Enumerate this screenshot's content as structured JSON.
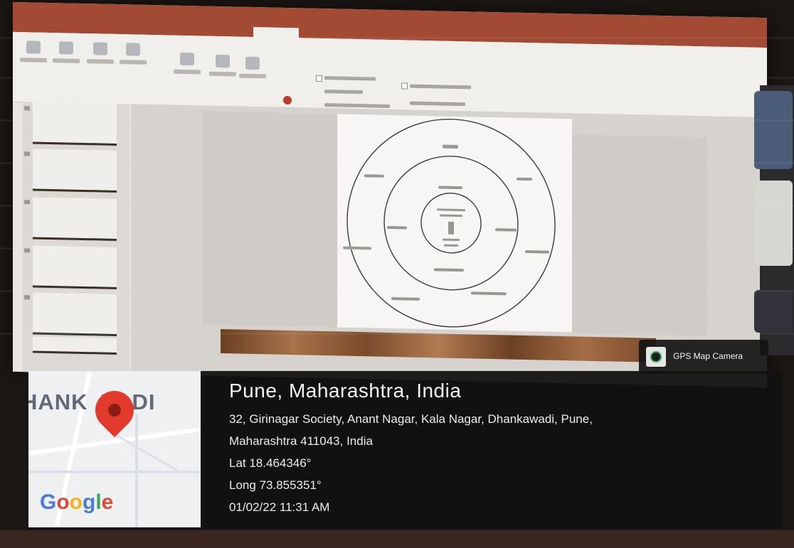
{
  "gps_overlay": {
    "badge_label": "GPS Map Camera",
    "place_title": "Pune, Maharashtra, India",
    "address_line1": "32, Girinagar Society, Anant Nagar, Kala Nagar, Dhankawadi, Pune,",
    "address_line2": "Maharashtra 411043, India",
    "latitude": "Lat 18.464346°",
    "longitude": "Long 73.855351°",
    "datetime": "01/02/22 11:31 AM"
  },
  "map_tile": {
    "place_label": "HANK  VADI",
    "brand": [
      "G",
      "o",
      "o",
      "g",
      "l",
      "e"
    ],
    "pin_icon": "map-pin-icon",
    "pin_color": "#e23a2c"
  },
  "colors": {
    "titlebar": "#a24a33",
    "overlay": "#121112"
  }
}
